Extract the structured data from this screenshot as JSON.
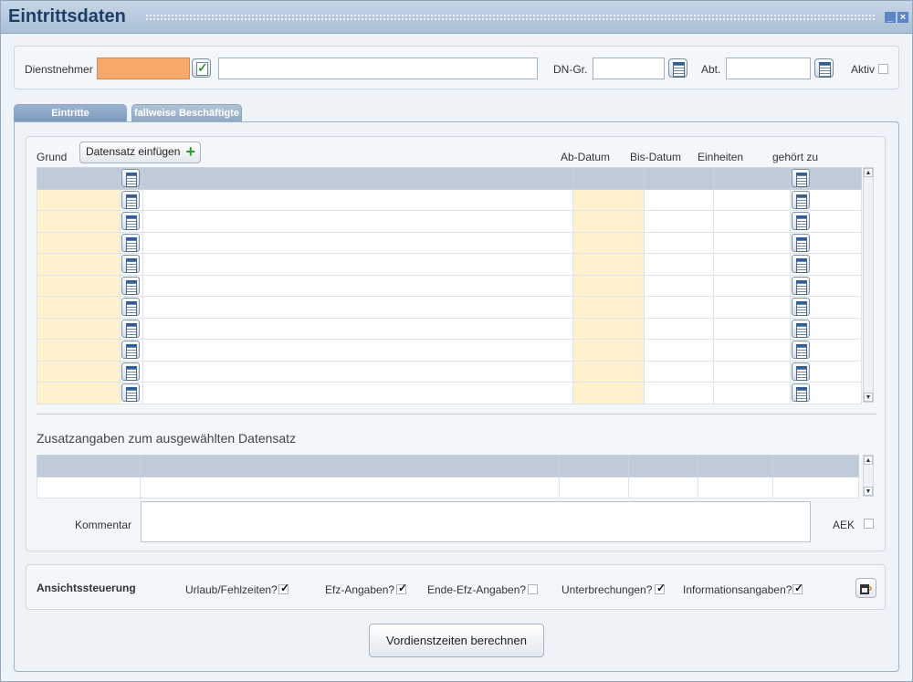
{
  "window": {
    "title": "Eintrittsdaten"
  },
  "header": {
    "employee_label": "Dienstnehmer",
    "employee_value": "",
    "employee_name": "",
    "dngr_label": "DN-Gr.",
    "dngr_value": "",
    "abt_label": "Abt.",
    "abt_value": "",
    "aktiv_label": "Aktiv"
  },
  "tabs": [
    {
      "label": "Eintritte",
      "active": true
    },
    {
      "label": "fallweise Beschäftigte",
      "active": false
    }
  ],
  "grid": {
    "grund_label": "Grund",
    "insert_button": "Datensatz einfügen",
    "columns": [
      "Ab-Datum",
      "Bis-Datum",
      "Einheiten",
      "gehört zu"
    ],
    "row_count": 10
  },
  "zusatz": {
    "title": "Zusatzangaben zum ausgewählten Datensatz",
    "comment_label": "Kommentar",
    "comment_value": "",
    "aek_label": "AEK"
  },
  "ansicht": {
    "title": "Ansichtssteuerung",
    "options": [
      {
        "label": "Urlaub/Fehlzeiten?",
        "checked": true
      },
      {
        "label": "Efz-Angaben?",
        "checked": true
      },
      {
        "label": "Ende-Efz-Angaben?",
        "checked": false
      },
      {
        "label": "Unterbrechungen?",
        "checked": true
      },
      {
        "label": "Informationsangaben?",
        "checked": true
      }
    ]
  },
  "footer": {
    "calc_button": "Vordienstzeiten berechnen"
  },
  "colors": {
    "accent_orange": "#f6a96a",
    "required_yellow": "#fff1ce",
    "title_blue": "#1f3e66"
  }
}
